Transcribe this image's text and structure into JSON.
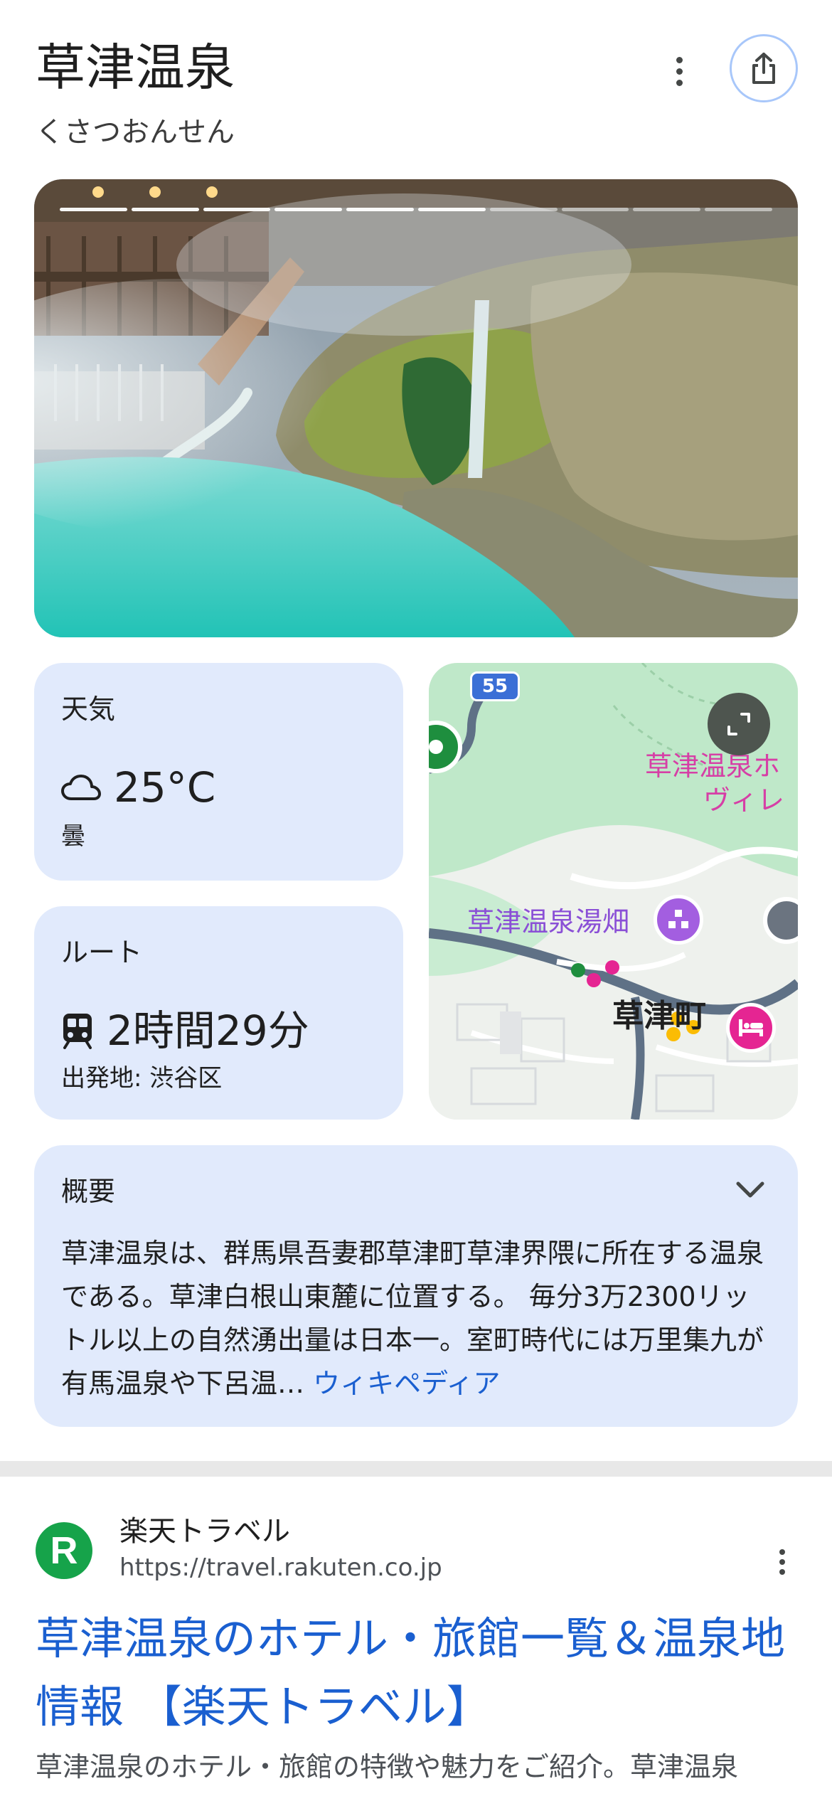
{
  "header": {
    "title": "草津温泉",
    "subtitle": "くさつおんせん"
  },
  "weather": {
    "label": "天気",
    "temperature": "25°C",
    "condition": "曇",
    "icon": "cloud-icon"
  },
  "route": {
    "label": "ルート",
    "duration": "2時間29分",
    "origin": "出発地: 渋谷区",
    "icon": "train-icon"
  },
  "map": {
    "route_badge": "55",
    "place_1_line1": "草津温泉ホ",
    "place_1_line2": "ヴィレ",
    "place_2": "草津温泉湯畑",
    "town": "草津町"
  },
  "overview": {
    "title": "概要",
    "text": "草津温泉は、群馬県吾妻郡草津町草津界隈に所在する温泉である。草津白根山東麓に位置する。 毎分3万2300リットル以上の自然湧出量は日本一。室町時代には万里集九が有馬温泉や下呂温…",
    "source_link": "ウィキペディア"
  },
  "result": {
    "site_name": "楽天トラベル",
    "url": "https://travel.rakuten.co.jp",
    "favicon_letter": "R",
    "title": "草津温泉のホテル・旅館一覧＆温泉地情報 【楽天トラベル】",
    "snippet": "草津温泉のホテル・旅館の特徴や魅力をご紹介。草津温泉"
  },
  "colors": {
    "card_bg": "#e1eafc",
    "link_blue": "#1a5fd0",
    "favicon_green": "#16a34a"
  }
}
